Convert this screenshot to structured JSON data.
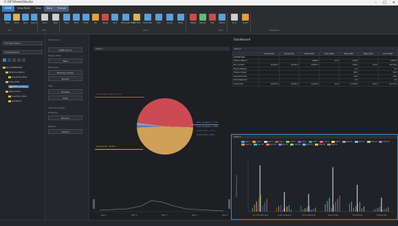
{
  "window": {
    "title": "C:\\SF\\Views\\Studio",
    "min": "–",
    "max": "□",
    "close": "✕"
  },
  "tabs": [
    "HOME",
    "View Mode",
    "View",
    "Data",
    "Format"
  ],
  "ribbon": {
    "buttons": [
      {
        "label": "New",
        "icon": "new-icon",
        "color": "#5aa0dc"
      },
      {
        "label": "Open",
        "icon": "open-icon",
        "color": "#d9b25a"
      },
      {
        "label": "Save",
        "icon": "save-icon",
        "color": "#5aa0dc"
      },
      {
        "label": "Save As",
        "icon": "save-as-icon",
        "color": "#5aa0dc"
      },
      {
        "label": "Undo",
        "icon": "undo-icon",
        "color": "#c9ced4"
      },
      {
        "label": "Redo",
        "icon": "redo-icon",
        "color": "#c9ced4"
      },
      {
        "label": "Table",
        "icon": "table-icon",
        "color": "#5aa0dc"
      },
      {
        "label": "Pivot",
        "icon": "pivot-icon",
        "color": "#5aa0dc"
      },
      {
        "label": "Chart",
        "icon": "chart-icon",
        "color": "#5aa0dc"
      },
      {
        "label": "Pie",
        "icon": "pie-icon",
        "color": "#e0a040"
      },
      {
        "label": "Gauge",
        "icon": "gauge-icon",
        "color": "#d04848"
      },
      {
        "label": "Card",
        "icon": "card-icon",
        "color": "#5aa0dc"
      },
      {
        "label": "Parameter Filter",
        "icon": "filter-icon",
        "color": "#5aa0dc"
      },
      {
        "label": "List Filter",
        "icon": "list-filter-icon",
        "color": "#d9b25a"
      },
      {
        "label": "Date Filter",
        "icon": "date-filter-icon",
        "color": "#5aa0dc"
      },
      {
        "label": "Text",
        "icon": "text-icon",
        "color": "#5aa0dc"
      },
      {
        "label": "Group",
        "icon": "group-icon",
        "color": "#5aa0dc"
      },
      {
        "label": "Ruler",
        "icon": "ruler-icon",
        "color": "#5aa0dc"
      },
      {
        "label": "Delete",
        "icon": "delete-icon",
        "color": "#d04848"
      },
      {
        "label": "Refresh",
        "icon": "refresh-icon",
        "color": "#5ac07a"
      },
      {
        "label": "Edit",
        "icon": "edit-icon",
        "color": "#d04848"
      },
      {
        "label": "Select",
        "icon": "select-icon",
        "color": "#5aa0dc"
      },
      {
        "label": "Print",
        "icon": "print-icon",
        "color": "#c9ced4"
      },
      {
        "label": "Export",
        "icon": "export-icon",
        "color": "#e0a040"
      }
    ],
    "groups": [
      "File",
      "Edit",
      "Items",
      "Tools",
      "Dashboard"
    ]
  },
  "nav": {
    "dropdown": "File View Sheet 1",
    "dropdown2": "All Dashboards",
    "items": [
      "My_DASHBOARD",
      "Revenue_Report",
      "Quarterly_Sales",
      "Data_2018",
      "Items_Analysis",
      "Sales Chart",
      "Inventory_Data",
      "Quantities"
    ]
  },
  "props": {
    "title1": "Data Source",
    "value1": "ODBC Source",
    "title2": "Display Mode",
    "value2": "Table",
    "title3": "Dimension",
    "value3": "Revenue_Column",
    "value3b": "Product",
    "title4": "Style",
    "value4": "Quantity",
    "value4b": "Sales",
    "title5": "Color Key & Style",
    "title6": "Dimension",
    "value6": "Revenue",
    "title7": "Measure",
    "value7": "Product"
  },
  "main": {
    "title": "Dashboard",
    "chart1_header": "Chart 1",
    "chart1_title": "Quantity Chart",
    "pivot_header": "Pivot 1",
    "chart2_header": "Chart 2",
    "pie_labels": [
      "Sun Hill Direct Mail - 50.47%",
      "Data, Grassland - 1.17%",
      "Fund, Grassland - 1.09%",
      "Green Forest - 1.12%",
      "Tourist Dept - 0.84%",
      "Orange Hills - 48.26%"
    ]
  },
  "pivot": {
    "columns": [
      "",
      "Grand 2014",
      "Grade 2014",
      "Grade 2015",
      "Grand 2016",
      "Basic 2016",
      "Mixed 2016",
      "Grand Total"
    ],
    "rows": [
      {
        "label": "ADVERTISING",
        "cells": [
          "",
          "",
          "",
          "",
          "",
          "",
          ""
        ]
      },
      {
        "label": "Alliance Referral",
        "cells": [
          "",
          "",
          "1,000.0",
          "21.0",
          "129.0",
          "",
          "1,152.0"
        ]
      },
      {
        "label": "Bio. Contract",
        "cells": [
          "10,447.0",
          "10,447.0",
          "10,447.0",
          "",
          "128.0",
          "710.0",
          "32,179.0"
        ]
      },
      {
        "label": "Electric Referral",
        "cells": [
          "",
          "",
          "",
          "",
          "1.0",
          "",
          "1.0"
        ]
      },
      {
        "label": "Feature Google",
        "cells": [
          "",
          "",
          "",
          "",
          "90.0",
          "",
          "90.0"
        ]
      },
      {
        "label": "Customer Event",
        "cells": [
          "",
          "",
          "",
          "",
          "12.0",
          "",
          "12.0"
        ]
      },
      {
        "label": "Direct Response",
        "cells": [
          "",
          "",
          "",
          "",
          "4.0",
          "",
          "4.0"
        ]
      },
      {
        "label": "Grand Total",
        "cells": [
          "10,447.0",
          "10,447.0",
          "11,447.0",
          "21.0",
          "17,190.0",
          "710.0",
          "51,172.0"
        ]
      }
    ]
  },
  "chart2": {
    "ylabel": "SUM(Profit-Plan-Count)",
    "xlabels": [
      "Sun Hill Direct Mail",
      "Data, Grassland",
      "Fund, Grassland",
      "Green Forest",
      "Tourist Dept",
      "Orange Hills"
    ],
    "legend": [
      {
        "name": "AAA 1",
        "color": "#5aa0dc"
      },
      {
        "name": "AAA 2",
        "color": "#e0a040"
      },
      {
        "name": "AAA 3",
        "color": "#c9ced4"
      },
      {
        "name": "AAA 4",
        "color": "#d04848"
      },
      {
        "name": "AAA 5",
        "color": "#8bc34a"
      },
      {
        "name": "AAA 6",
        "color": "#7e57c2"
      },
      {
        "name": "AAA 7",
        "color": "#26a69a"
      },
      {
        "name": "AAA 8",
        "color": "#f06292"
      },
      {
        "name": "AAA 9",
        "color": "#ffd54f"
      },
      {
        "name": "AAA 10",
        "color": "#90a4ae"
      },
      {
        "name": "AAA 11",
        "color": "#4fc3f7"
      },
      {
        "name": "AAA 12",
        "color": "#aed581"
      },
      {
        "name": "AAA 13",
        "color": "#ba68c8"
      },
      {
        "name": "AAA 14",
        "color": "#ff8a65"
      },
      {
        "name": "AAA 15",
        "color": "#4db6ac"
      },
      {
        "name": "AAA 16",
        "color": "#e57373"
      },
      {
        "name": "AAA 17",
        "color": "#9575cd"
      },
      {
        "name": "AAA 18",
        "color": "#81c784"
      },
      {
        "name": "AAA 19",
        "color": "#64b5f6"
      },
      {
        "name": "AAA 20",
        "color": "#ffb74d"
      },
      {
        "name": "AAA 21",
        "color": "#a1887f"
      }
    ]
  },
  "trend": {
    "xlabels": [
      "Item 1",
      "Item 2",
      "Item 3",
      "Item 4",
      "Item 5"
    ]
  },
  "chart_data": {
    "type": "bar",
    "ylabel": "SUM(Profit-Plan-Count)",
    "categories": [
      "Sun Hill Direct Mail",
      "Data, Grassland",
      "Fund, Grassland",
      "Green Forest",
      "Tourist Dept",
      "Orange Hills"
    ],
    "series": [
      {
        "name": "Peak",
        "values": [
          100,
          42,
          38,
          96,
          58,
          30
        ]
      }
    ],
    "ylim": [
      0,
      110
    ]
  }
}
